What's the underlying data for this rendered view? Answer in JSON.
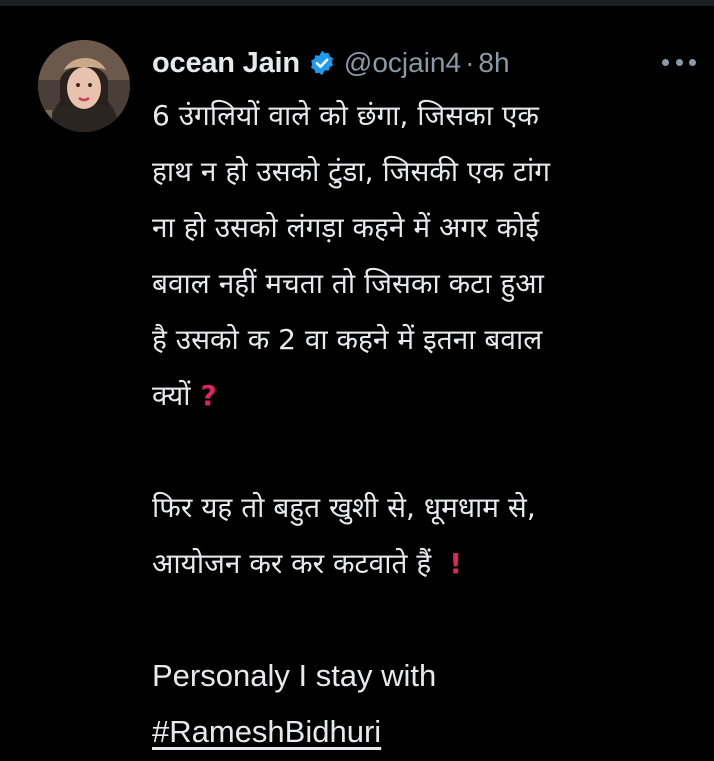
{
  "tweet": {
    "author": {
      "display_name": "ocean Jain",
      "handle": "@ocjain4",
      "separator": "·",
      "time": "8h",
      "verified_icon": "verified-badge-icon",
      "avatar": "profile-photo"
    },
    "more_icon": "more-options-icon",
    "lines": {
      "l1": "6 उंगलियों वाले को छंगा, जिसका एक",
      "l2": "हाथ न  हो उसको टुंडा, जिसकी एक टांग",
      "l3": "ना हो उसको लंगड़ा कहने में अगर कोई",
      "l4": "बवाल नहीं मचता तो जिसका कटा हुआ",
      "l5": "है उसको क 2 वा कहने में इतना बवाल",
      "l6": "क्यों",
      "l6_mark": "?",
      "l7": "फिर यह तो बहुत खुशी से, धूमधाम से,",
      "l8": "आयोजन कर कर कटवाते हैं",
      "l8_mark": "!",
      "l9": "Personaly I stay with",
      "hashtag": "#RameshBidhuri"
    },
    "colors": {
      "background": "#000000",
      "text": "#e7e9ea",
      "secondary": "#8b98a5",
      "verified": "#1d9bf0",
      "mark": "#e0245e"
    }
  }
}
